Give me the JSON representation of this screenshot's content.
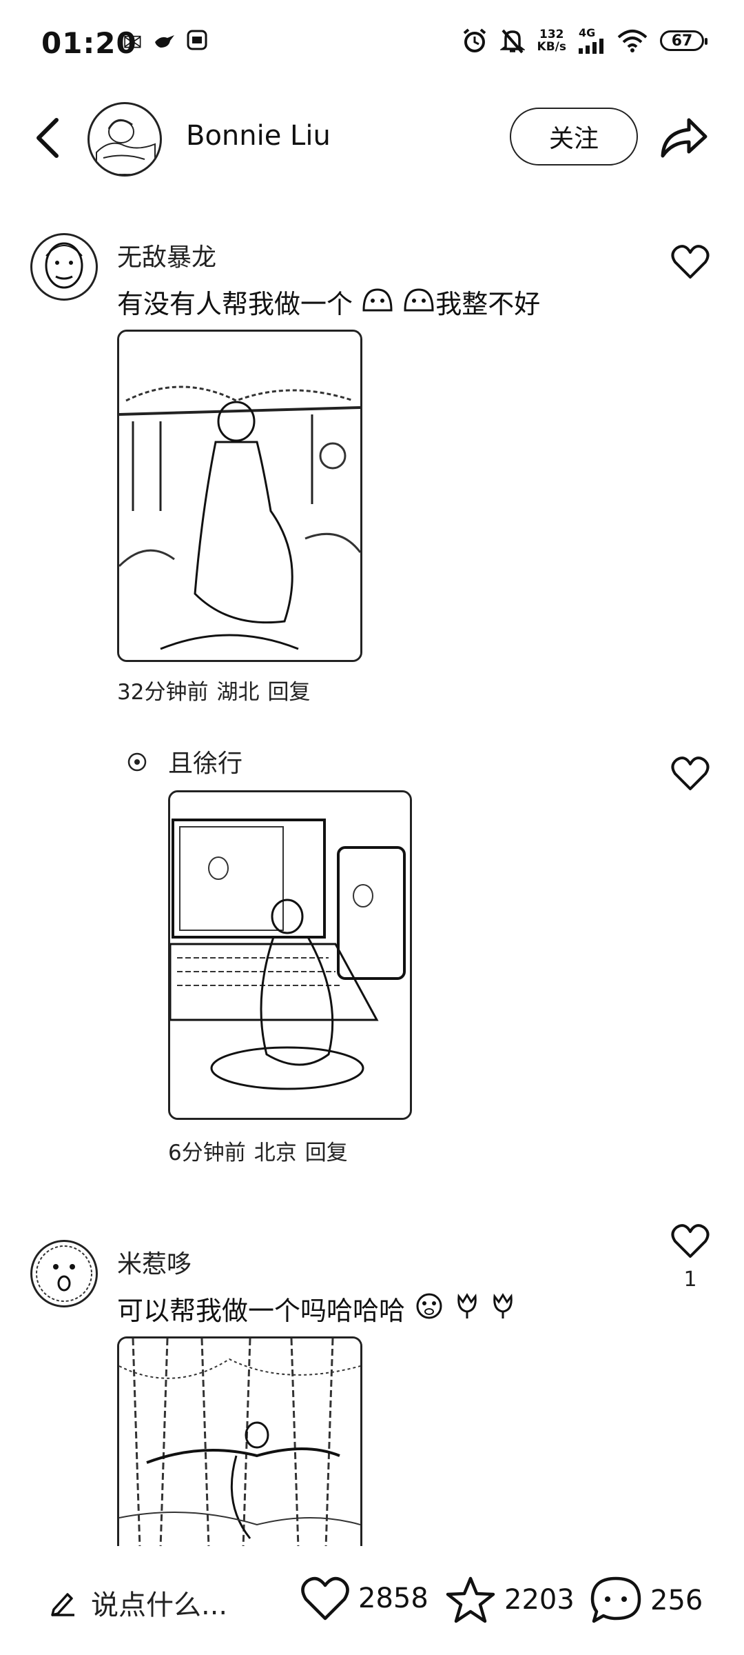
{
  "status_bar": {
    "time": "01:20",
    "net_speed_value": "132",
    "net_speed_unit": "KB/s",
    "network": "4G",
    "battery": "67",
    "left_icons": [
      "mail-icon",
      "bird-icon",
      "app-icon"
    ],
    "right_icons": [
      "alarm-icon",
      "mute-icon",
      "signal-icon",
      "wifi-icon",
      "battery-icon"
    ]
  },
  "header": {
    "user_name": "Bonnie Liu",
    "follow_label": "关注"
  },
  "comments": [
    {
      "name": "无敌暴龙",
      "text": "有没有人帮我做一个",
      "text_suffix": "我整不好",
      "emojis": [
        "emoji-icon",
        "emoji-icon"
      ],
      "time": "32分钟前",
      "location": "湖北",
      "reply_label": "回复",
      "like_count": ""
    },
    {
      "name": "且徐行",
      "text": "",
      "time": "6分钟前",
      "location": "北京",
      "reply_label": "回复",
      "like_count": ""
    },
    {
      "name": "米惹哆",
      "text": "可以帮我做一个吗哈哈哈",
      "emojis": [
        "emoji-icon",
        "tulip-icon",
        "tulip-icon"
      ],
      "like_count": "1"
    }
  ],
  "bottom_bar": {
    "comment_placeholder": "说点什么...",
    "likes": "2858",
    "favorites": "2203",
    "comments": "256"
  }
}
